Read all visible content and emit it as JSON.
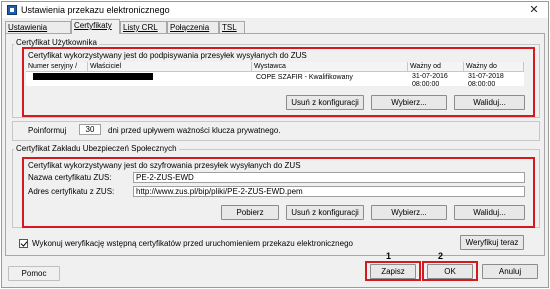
{
  "window": {
    "title": "Ustawienia przekazu elektronicznego",
    "close_glyph": "✕"
  },
  "tabs": [
    "Ustawienia ogólne",
    "Certyfikaty",
    "Listy CRL",
    "Połączenia",
    "TSL"
  ],
  "user_cert": {
    "group_label": "Certyfikat Użytkownika",
    "description": "Certyfikat wykorzystywany jest do podpisywania przesyłek wysyłanych do ZUS",
    "columns": [
      "Numer seryjny",
      "Właściciel",
      "Wystawca",
      "Ważny od",
      "Ważny do"
    ],
    "sort_indicator": "/",
    "row": {
      "issuer": "COPE SZAFIR - Kwalifikowany",
      "valid_from_date": "31-07-2016",
      "valid_from_time": "08:00:00",
      "valid_to_date": "31-07-2018",
      "valid_to_time": "08:00:00"
    },
    "buttons": {
      "remove": "Usuń z konfiguracji",
      "choose": "Wybierz...",
      "validate": "Waliduj..."
    }
  },
  "reminder": {
    "prefix": "Poinformuj",
    "days_value": "30",
    "suffix": "dni przed upływem ważności klucza prywatnego."
  },
  "zus_cert": {
    "group_label": "Certyfikat Zakładu Ubezpieczeń Społecznych",
    "description": "Certyfikat wykorzystywany jest do szyfrowania przesyłek wysyłanych do ZUS",
    "name_label": "Nazwa certyfikatu ZUS:",
    "name_value": "PE-2-ZUS-EWD",
    "address_label": "Adres certyfikatu z ZUS:",
    "address_value": "http://www.zus.pl/bip/pliki/PE-2-ZUS-EWD.pem",
    "buttons": {
      "download": "Pobierz",
      "remove": "Usuń z konfiguracji",
      "choose": "Wybierz...",
      "validate": "Waliduj..."
    }
  },
  "verification": {
    "checkbox_label": "Wykonuj weryfikację wstępną certyfikatów przed uruchomieniem przekazu elektronicznego",
    "checked": true,
    "button": "Weryfikuj teraz"
  },
  "footer": {
    "help": "Pomoc",
    "save": "Zapisz",
    "ok": "OK",
    "cancel": "Anuluj"
  },
  "annotations": {
    "save_number": "1",
    "ok_number": "2",
    "highlight_color": "#d6191f"
  }
}
